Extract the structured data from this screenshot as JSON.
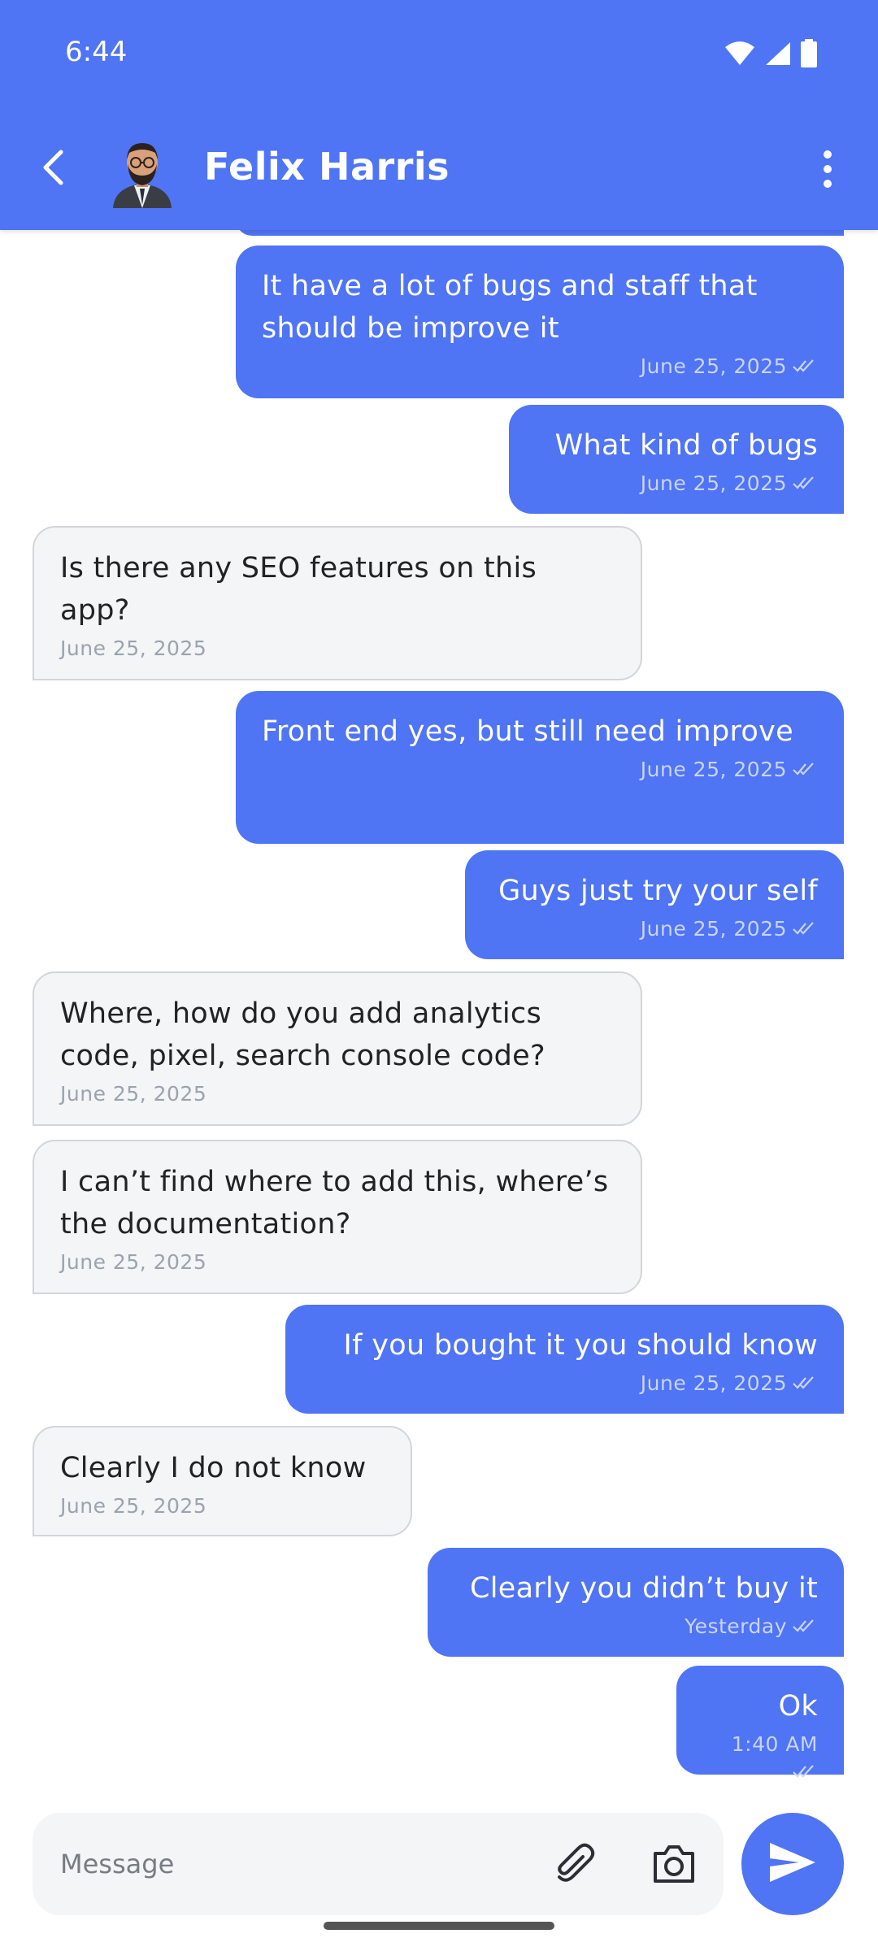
{
  "status_bar": {
    "time": "6:44"
  },
  "header": {
    "contact_name": "Felix Harris"
  },
  "messages": [
    {
      "direction": "out",
      "text": "It have a lot of bugs and staff that should be improve it",
      "time": "June 25, 2025"
    },
    {
      "direction": "out",
      "text": "What kind of bugs",
      "time": "June 25, 2025"
    },
    {
      "direction": "in",
      "text": "Is there any SEO features on this app?",
      "time": "June 25, 2025"
    },
    {
      "direction": "out",
      "text": "Front end yes, but still need improve",
      "time": "June 25, 2025"
    },
    {
      "direction": "out",
      "text": "Guys just try your self",
      "time": "June 25, 2025"
    },
    {
      "direction": "in",
      "text": "Where, how do you add analytics code, pixel, search console code?",
      "time": "June 25, 2025"
    },
    {
      "direction": "in",
      "text": "I can’t find where to add this, where’s the documentation?",
      "time": "June 25, 2025"
    },
    {
      "direction": "out",
      "text": "If you bought it you should know",
      "time": "June 25, 2025"
    },
    {
      "direction": "in",
      "text": "Clearly I do not know",
      "time": "June 25, 2025"
    },
    {
      "direction": "out",
      "text": "Clearly you didn’t buy it",
      "time": "Yesterday"
    },
    {
      "direction": "out",
      "text": "Ok",
      "time": "1:40 AM"
    }
  ],
  "composer": {
    "placeholder": "Message"
  },
  "icons": {
    "back": "chevron-left-icon",
    "more": "more-vertical-icon",
    "attach": "paperclip-icon",
    "camera": "camera-icon",
    "send": "send-icon",
    "read": "double-check-icon"
  },
  "colors": {
    "primary": "#4F74F4",
    "incoming_bubble": "#F4F5F7",
    "incoming_border": "#D3D5DA",
    "outgoing_meta": "#C9D4FB",
    "incoming_meta": "#9AA3AE"
  }
}
